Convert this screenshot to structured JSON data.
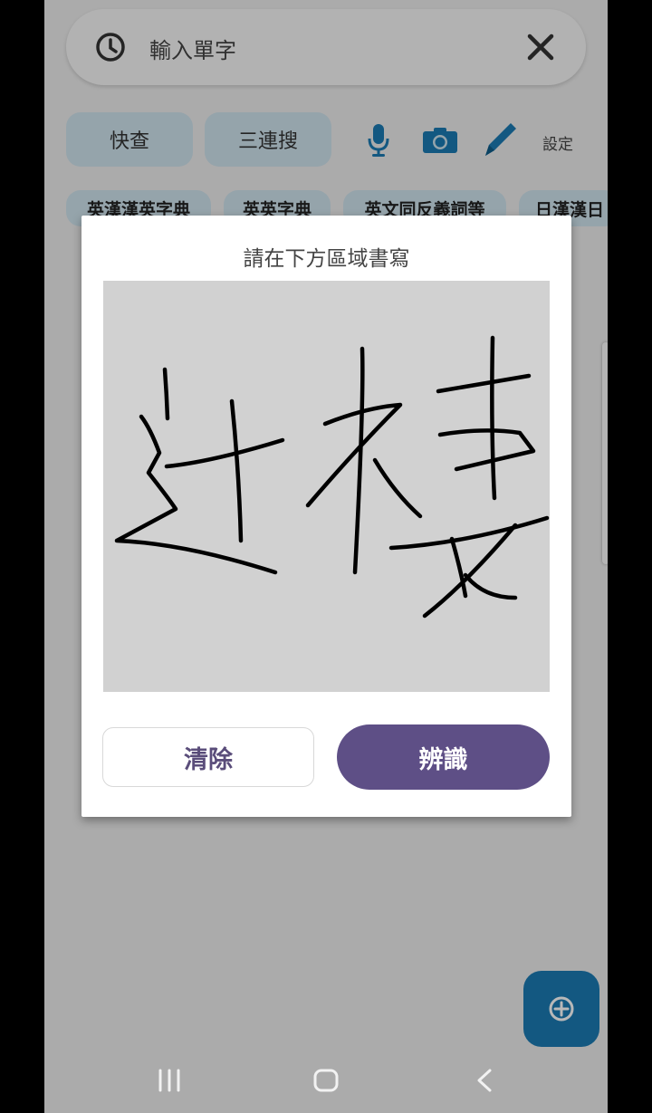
{
  "search": {
    "text": "輸入單字"
  },
  "actions": {
    "quick_lookup": "快查",
    "triple_search": "三連搜",
    "settings": "設定"
  },
  "dict_tabs": [
    "英漢漢英字典",
    "英英字典",
    "英文同反義詞等",
    "日漢漢日"
  ],
  "dialog": {
    "title": "請在下方區域書寫",
    "clear_label": "清除",
    "recognize_label": "辨識"
  },
  "colors": {
    "accent": "#5e4f86",
    "pill": "#cfe3ee",
    "fab": "#1b7bb3",
    "canvas": "#d1d1d1"
  },
  "icons": {
    "history": "history-icon",
    "close": "close-icon",
    "mic": "microphone-icon",
    "camera": "camera-icon",
    "pen": "pen-icon",
    "fab": "plus-circle-icon",
    "nav_recent": "recent-apps-icon",
    "nav_home": "home-icon",
    "nav_back": "back-icon"
  }
}
